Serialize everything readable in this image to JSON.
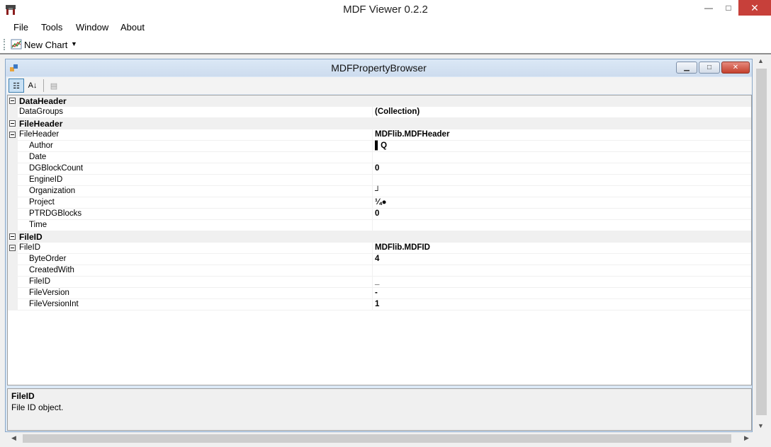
{
  "window": {
    "title": "MDF Viewer 0.2.2",
    "minimize": "—",
    "maximize": "□",
    "close": "✕"
  },
  "menu": [
    "File",
    "Tools",
    "Window",
    "About"
  ],
  "toolbar": {
    "new_chart_label": "New Chart",
    "dropdown_arrow": "▼"
  },
  "child": {
    "title": "MDFPropertyBrowser",
    "minimize": "▁",
    "maximize": "□",
    "close": "✕"
  },
  "property_toolbar": {
    "categorized": "☷",
    "alphabetical": "A↓",
    "pages": "▤"
  },
  "rows": [
    {
      "kind": "cat",
      "name": "DataHeader",
      "value": ""
    },
    {
      "kind": "prop",
      "level": 1,
      "name": "DataGroups",
      "value": "(Collection)"
    },
    {
      "kind": "cat",
      "name": "FileHeader",
      "value": ""
    },
    {
      "kind": "prop",
      "level": 1,
      "expand": true,
      "name": "FileHeader",
      "value": "MDFlib.MDFHeader"
    },
    {
      "kind": "prop",
      "level": 2,
      "name": "Author",
      "value": "▌Q"
    },
    {
      "kind": "prop",
      "level": 2,
      "name": "Date",
      "value": ""
    },
    {
      "kind": "prop",
      "level": 2,
      "name": "DGBlockCount",
      "value": "0"
    },
    {
      "kind": "prop",
      "level": 2,
      "name": "EngineID",
      "value": ""
    },
    {
      "kind": "prop",
      "level": 2,
      "name": "Organization",
      "value": "┘"
    },
    {
      "kind": "prop",
      "level": 2,
      "name": "Project",
      "value": "¼●"
    },
    {
      "kind": "prop",
      "level": 2,
      "name": "PTRDGBlocks",
      "value": "0"
    },
    {
      "kind": "prop",
      "level": 2,
      "name": "Time",
      "value": ""
    },
    {
      "kind": "cat",
      "name": "FileID",
      "value": ""
    },
    {
      "kind": "prop",
      "level": 1,
      "expand": true,
      "name": "FileID",
      "value": "MDFlib.MDFID"
    },
    {
      "kind": "prop",
      "level": 2,
      "name": "ByteOrder",
      "value": "4"
    },
    {
      "kind": "prop",
      "level": 2,
      "name": "CreatedWith",
      "value": ""
    },
    {
      "kind": "prop",
      "level": 2,
      "name": "FileID",
      "value": "_"
    },
    {
      "kind": "prop",
      "level": 2,
      "name": "FileVersion",
      "value": "-"
    },
    {
      "kind": "prop",
      "level": 2,
      "name": "FileVersionInt",
      "value": "1"
    }
  ],
  "help": {
    "title": "FileID",
    "description": "File ID object."
  },
  "scroll": {
    "up": "▲",
    "down": "▼",
    "left": "◀",
    "right": "▶"
  }
}
